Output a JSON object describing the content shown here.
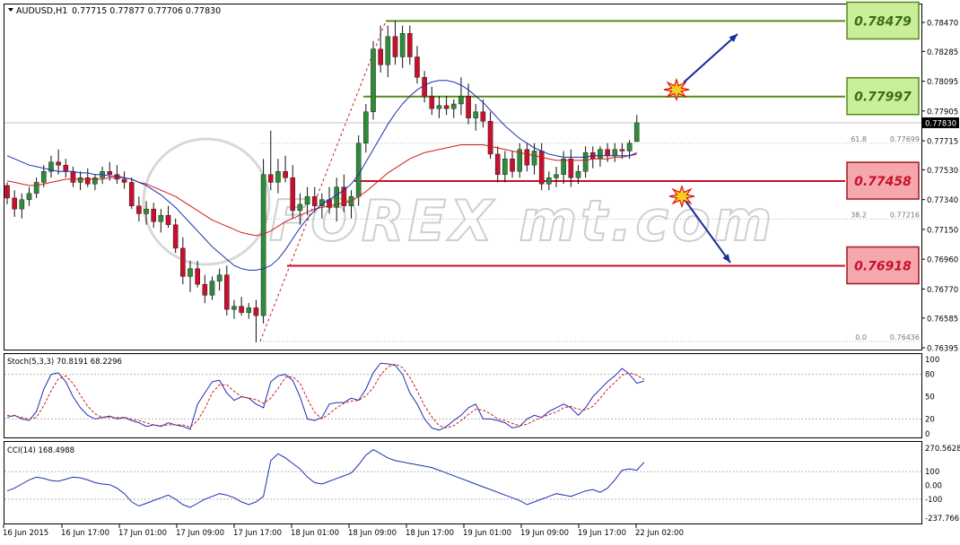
{
  "header": {
    "symbol": "AUDUSD,H1",
    "ohlc": "0.77715 0.77877 0.77706 0.77830"
  },
  "level_boxes": [
    {
      "label": "0.78479",
      "kind": "resistance",
      "value": 0.78479
    },
    {
      "label": "0.77997",
      "kind": "resistance",
      "value": 0.77997
    },
    {
      "label": "0.77458",
      "kind": "support",
      "value": 0.77458
    },
    {
      "label": "0.76918",
      "kind": "support",
      "value": 0.76918
    }
  ],
  "fib_labels": [
    {
      "label": "61.8",
      "value_text": "0.77699",
      "value": 0.77699
    },
    {
      "label": "38.2",
      "value_text": "0.77216",
      "value": 0.77216
    },
    {
      "label": "0.0",
      "value_text": "0.76436",
      "value": 0.76436
    }
  ],
  "price_axis": {
    "ticks": [
      "0.78470",
      "0.78285",
      "0.78095",
      "0.77905",
      "0.77715",
      "0.77530",
      "0.77340",
      "0.77150",
      "0.76960",
      "0.76770",
      "0.76585",
      "0.76395"
    ],
    "current": "0.77830"
  },
  "stoch": {
    "label": "Stoch(5,3,3) 70.8191 68.2296",
    "ticks": [
      "100",
      "80",
      "50",
      "20",
      "0"
    ]
  },
  "cci": {
    "label": "CCI(14) 168.4988",
    "ticks": [
      "270.5628",
      "100",
      "0.00",
      "-100",
      "-237.7663"
    ]
  },
  "time_axis": [
    "16 Jun 2015",
    "16 Jun 17:00",
    "17 Jun 01:00",
    "17 Jun 09:00",
    "17 Jun 17:00",
    "18 Jun 01:00",
    "18 Jun 09:00",
    "18 Jun 17:00",
    "19 Jun 01:00",
    "19 Jun 09:00",
    "19 Jun 17:00",
    "22 Jun 02:00"
  ],
  "watermark": "FOREX mt.com",
  "colors": {
    "bull": "#2e8b3a",
    "bear": "#c8102e",
    "ma_fast": "#d11a1a",
    "ma_slow": "#1c2fb0",
    "support": "#c8102e",
    "resistance": "#5a8a1a",
    "support_box_fill": "#f4a7ac",
    "resistance_box_fill": "#c9ef9b",
    "arrow": "#1a2b9a",
    "burst": "#f5d020"
  },
  "chart_data": {
    "type": "candlestick",
    "symbol": "AUDUSD",
    "timeframe": "H1",
    "ylim": [
      0.76395,
      0.7856
    ],
    "candles": [
      [
        0.7743,
        0.7745,
        0.7731,
        0.7735
      ],
      [
        0.7735,
        0.774,
        0.7723,
        0.7728
      ],
      [
        0.7728,
        0.7738,
        0.7722,
        0.7734
      ],
      [
        0.7734,
        0.7742,
        0.773,
        0.7738
      ],
      [
        0.7738,
        0.7748,
        0.7735,
        0.7745
      ],
      [
        0.7745,
        0.7756,
        0.7742,
        0.7752
      ],
      [
        0.7752,
        0.7762,
        0.7748,
        0.7758
      ],
      [
        0.7758,
        0.7766,
        0.775,
        0.7756
      ],
      [
        0.7756,
        0.776,
        0.7748,
        0.7752
      ],
      [
        0.7752,
        0.7755,
        0.7742,
        0.7745
      ],
      [
        0.7745,
        0.7752,
        0.774,
        0.7748
      ],
      [
        0.7748,
        0.7754,
        0.7742,
        0.7744
      ],
      [
        0.7744,
        0.775,
        0.774,
        0.7748
      ],
      [
        0.7748,
        0.7755,
        0.7744,
        0.7752
      ],
      [
        0.7752,
        0.7758,
        0.7746,
        0.775
      ],
      [
        0.775,
        0.7756,
        0.7744,
        0.7747
      ],
      [
        0.7747,
        0.7752,
        0.7741,
        0.7745
      ],
      [
        0.7745,
        0.7748,
        0.7728,
        0.773
      ],
      [
        0.773,
        0.7736,
        0.772,
        0.7725
      ],
      [
        0.7725,
        0.7733,
        0.7718,
        0.7728
      ],
      [
        0.7728,
        0.7732,
        0.7716,
        0.772
      ],
      [
        0.772,
        0.7728,
        0.7713,
        0.7724
      ],
      [
        0.7724,
        0.773,
        0.7716,
        0.7718
      ],
      [
        0.7718,
        0.7722,
        0.77,
        0.7703
      ],
      [
        0.7703,
        0.771,
        0.768,
        0.7685
      ],
      [
        0.7685,
        0.7695,
        0.7675,
        0.769
      ],
      [
        0.769,
        0.7695,
        0.7678,
        0.768
      ],
      [
        0.768,
        0.7686,
        0.7668,
        0.7673
      ],
      [
        0.7673,
        0.7685,
        0.767,
        0.7682
      ],
      [
        0.7682,
        0.769,
        0.7676,
        0.7686
      ],
      [
        0.7686,
        0.7692,
        0.766,
        0.7664
      ],
      [
        0.7664,
        0.767,
        0.7658,
        0.7666
      ],
      [
        0.7666,
        0.7672,
        0.766,
        0.7662
      ],
      [
        0.7662,
        0.7668,
        0.7658,
        0.7665
      ],
      [
        0.7665,
        0.767,
        0.7643,
        0.766
      ],
      [
        0.766,
        0.776,
        0.7655,
        0.775
      ],
      [
        0.775,
        0.7778,
        0.774,
        0.7745
      ],
      [
        0.7745,
        0.776,
        0.7738,
        0.7752
      ],
      [
        0.7752,
        0.7762,
        0.7745,
        0.7748
      ],
      [
        0.7748,
        0.7756,
        0.7722,
        0.7727
      ],
      [
        0.7727,
        0.7738,
        0.7718,
        0.7731
      ],
      [
        0.7731,
        0.7742,
        0.7724,
        0.7736
      ],
      [
        0.7736,
        0.7742,
        0.7726,
        0.773
      ],
      [
        0.773,
        0.7738,
        0.7722,
        0.7734
      ],
      [
        0.7734,
        0.7742,
        0.7725,
        0.7729
      ],
      [
        0.7729,
        0.7748,
        0.772,
        0.7742
      ],
      [
        0.7742,
        0.775,
        0.7726,
        0.773
      ],
      [
        0.773,
        0.774,
        0.7722,
        0.7736
      ],
      [
        0.7736,
        0.7775,
        0.773,
        0.777
      ],
      [
        0.777,
        0.7795,
        0.7764,
        0.779
      ],
      [
        0.779,
        0.7835,
        0.7785,
        0.783
      ],
      [
        0.783,
        0.7845,
        0.7815,
        0.782
      ],
      [
        0.782,
        0.7845,
        0.7812,
        0.7838
      ],
      [
        0.7838,
        0.7848,
        0.782,
        0.7825
      ],
      [
        0.7825,
        0.7845,
        0.7818,
        0.784
      ],
      [
        0.784,
        0.7845,
        0.782,
        0.7825
      ],
      [
        0.7825,
        0.7832,
        0.7808,
        0.7812
      ],
      [
        0.7812,
        0.7816,
        0.7796,
        0.78
      ],
      [
        0.78,
        0.7806,
        0.7788,
        0.7792
      ],
      [
        0.7792,
        0.78,
        0.7786,
        0.7794
      ],
      [
        0.7794,
        0.78,
        0.7788,
        0.7792
      ],
      [
        0.7792,
        0.7798,
        0.7786,
        0.7795
      ],
      [
        0.7795,
        0.7812,
        0.7788,
        0.78
      ],
      [
        0.78,
        0.7808,
        0.7782,
        0.7786
      ],
      [
        0.7786,
        0.7795,
        0.7778,
        0.779
      ],
      [
        0.779,
        0.7798,
        0.778,
        0.7784
      ],
      [
        0.7784,
        0.779,
        0.776,
        0.7763
      ],
      [
        0.7763,
        0.7768,
        0.7745,
        0.775
      ],
      [
        0.775,
        0.7765,
        0.7745,
        0.776
      ],
      [
        0.776,
        0.7765,
        0.7748,
        0.7752
      ],
      [
        0.7752,
        0.777,
        0.7748,
        0.7766
      ],
      [
        0.7766,
        0.777,
        0.7752,
        0.7756
      ],
      [
        0.7756,
        0.777,
        0.775,
        0.7765
      ],
      [
        0.7765,
        0.777,
        0.774,
        0.7744
      ],
      [
        0.7744,
        0.7752,
        0.774,
        0.7748
      ],
      [
        0.7748,
        0.7755,
        0.7742,
        0.775
      ],
      [
        0.775,
        0.7765,
        0.7744,
        0.776
      ],
      [
        0.776,
        0.7766,
        0.7742,
        0.7748
      ],
      [
        0.7748,
        0.7756,
        0.7744,
        0.7752
      ],
      [
        0.7752,
        0.7768,
        0.7748,
        0.7764
      ],
      [
        0.7764,
        0.7768,
        0.7754,
        0.776
      ],
      [
        0.776,
        0.7768,
        0.7755,
        0.7766
      ],
      [
        0.7766,
        0.777,
        0.7758,
        0.7762
      ],
      [
        0.7762,
        0.777,
        0.7758,
        0.7766
      ],
      [
        0.7766,
        0.777,
        0.776,
        0.7765
      ],
      [
        0.7765,
        0.7772,
        0.776,
        0.777
      ],
      [
        0.7771,
        0.7788,
        0.7771,
        0.7783
      ]
    ],
    "series": [
      {
        "name": "MA fast",
        "values": [
          0.7746,
          0.7745,
          0.7744,
          0.7743,
          0.7743,
          0.7744,
          0.7745,
          0.7746,
          0.7747,
          0.7747,
          0.7747,
          0.7747,
          0.7747,
          0.7747,
          0.7748,
          0.7748,
          0.7748,
          0.7747,
          0.7745,
          0.7744,
          0.7742,
          0.774,
          0.7738,
          0.7736,
          0.7733,
          0.773,
          0.7727,
          0.7724,
          0.7721,
          0.7719,
          0.7717,
          0.7715,
          0.7713,
          0.7712,
          0.7711,
          0.7712,
          0.7714,
          0.7717,
          0.772,
          0.7722,
          0.7724,
          0.7726,
          0.7728,
          0.7729,
          0.773,
          0.7731,
          0.7732,
          0.7733,
          0.7736,
          0.7739,
          0.7743,
          0.7747,
          0.7751,
          0.7754,
          0.7757,
          0.776,
          0.7762,
          0.7764,
          0.7765,
          0.7766,
          0.7767,
          0.7768,
          0.7769,
          0.7769,
          0.7769,
          0.7769,
          0.7768,
          0.7767,
          0.7766,
          0.7765,
          0.7764,
          0.7763,
          0.7762,
          0.7761,
          0.776,
          0.7759,
          0.7759,
          0.7759,
          0.7759,
          0.7759,
          0.776,
          0.776,
          0.776,
          0.7761,
          0.7761,
          0.7762,
          0.7764
        ]
      },
      {
        "name": "MA slow",
        "values": [
          0.7762,
          0.776,
          0.7758,
          0.7756,
          0.7755,
          0.7754,
          0.7753,
          0.7752,
          0.7752,
          0.7752,
          0.7751,
          0.7751,
          0.775,
          0.775,
          0.7749,
          0.7749,
          0.7748,
          0.7747,
          0.7745,
          0.7743,
          0.774,
          0.7737,
          0.7733,
          0.7729,
          0.7724,
          0.7719,
          0.7714,
          0.7709,
          0.7704,
          0.77,
          0.7696,
          0.7692,
          0.769,
          0.7689,
          0.7689,
          0.769,
          0.7692,
          0.7696,
          0.7702,
          0.7709,
          0.7716,
          0.7722,
          0.7727,
          0.7731,
          0.7734,
          0.7737,
          0.774,
          0.7744,
          0.775,
          0.7758,
          0.7766,
          0.7774,
          0.7782,
          0.7789,
          0.7795,
          0.78,
          0.7804,
          0.7807,
          0.7809,
          0.781,
          0.781,
          0.7809,
          0.7807,
          0.7804,
          0.78,
          0.7796,
          0.7791,
          0.7786,
          0.7781,
          0.7777,
          0.7773,
          0.777,
          0.7767,
          0.7765,
          0.7763,
          0.7762,
          0.7761,
          0.7761,
          0.7761,
          0.7761,
          0.7762,
          0.7762,
          0.7762,
          0.7762,
          0.7762,
          0.7762,
          0.7763
        ]
      },
      {
        "name": "Stoch main",
        "values": [
          22,
          25,
          20,
          18,
          30,
          60,
          80,
          82,
          70,
          50,
          35,
          25,
          20,
          22,
          24,
          20,
          22,
          18,
          15,
          10,
          12,
          10,
          15,
          12,
          10,
          6,
          40,
          55,
          70,
          72,
          55,
          45,
          50,
          48,
          40,
          35,
          70,
          78,
          80,
          72,
          50,
          20,
          18,
          22,
          40,
          42,
          42,
          48,
          45,
          60,
          82,
          95,
          94,
          92,
          80,
          55,
          40,
          20,
          8,
          5,
          10,
          18,
          25,
          35,
          40,
          20,
          20,
          18,
          15,
          8,
          10,
          20,
          25,
          22,
          30,
          35,
          40,
          35,
          25,
          35,
          50,
          60,
          70,
          78,
          88,
          80,
          68,
          71
        ]
      },
      {
        "name": "Stoch signal",
        "values": [
          25,
          24,
          22,
          20,
          22,
          38,
          58,
          74,
          78,
          68,
          52,
          37,
          27,
          22,
          22,
          22,
          22,
          20,
          18,
          15,
          12,
          11,
          12,
          12,
          12,
          9,
          18,
          34,
          55,
          66,
          66,
          57,
          50,
          48,
          46,
          41,
          48,
          61,
          76,
          77,
          68,
          47,
          29,
          20,
          27,
          35,
          41,
          44,
          45,
          51,
          62,
          79,
          90,
          94,
          89,
          76,
          58,
          38,
          23,
          11,
          8,
          11,
          18,
          26,
          33,
          32,
          27,
          20,
          18,
          14,
          11,
          13,
          18,
          22,
          26,
          29,
          35,
          37,
          33,
          32,
          37,
          48,
          60,
          69,
          79,
          82,
          79,
          73
        ]
      },
      {
        "name": "CCI",
        "values": [
          -40,
          -20,
          10,
          40,
          60,
          50,
          35,
          30,
          45,
          60,
          55,
          40,
          20,
          10,
          5,
          -20,
          -60,
          -120,
          -150,
          -130,
          -110,
          -90,
          -70,
          -100,
          -140,
          -160,
          -130,
          -100,
          -80,
          -60,
          -70,
          -90,
          -120,
          -140,
          -120,
          -80,
          180,
          230,
          200,
          160,
          120,
          60,
          20,
          10,
          30,
          50,
          70,
          90,
          150,
          220,
          260,
          230,
          200,
          180,
          170,
          160,
          150,
          140,
          130,
          110,
          90,
          70,
          50,
          30,
          10,
          -10,
          -30,
          -50,
          -70,
          -90,
          -110,
          -140,
          -120,
          -100,
          -80,
          -60,
          -70,
          -80,
          -60,
          -40,
          -30,
          -50,
          -20,
          40,
          110,
          120,
          110,
          168
        ]
      }
    ]
  }
}
